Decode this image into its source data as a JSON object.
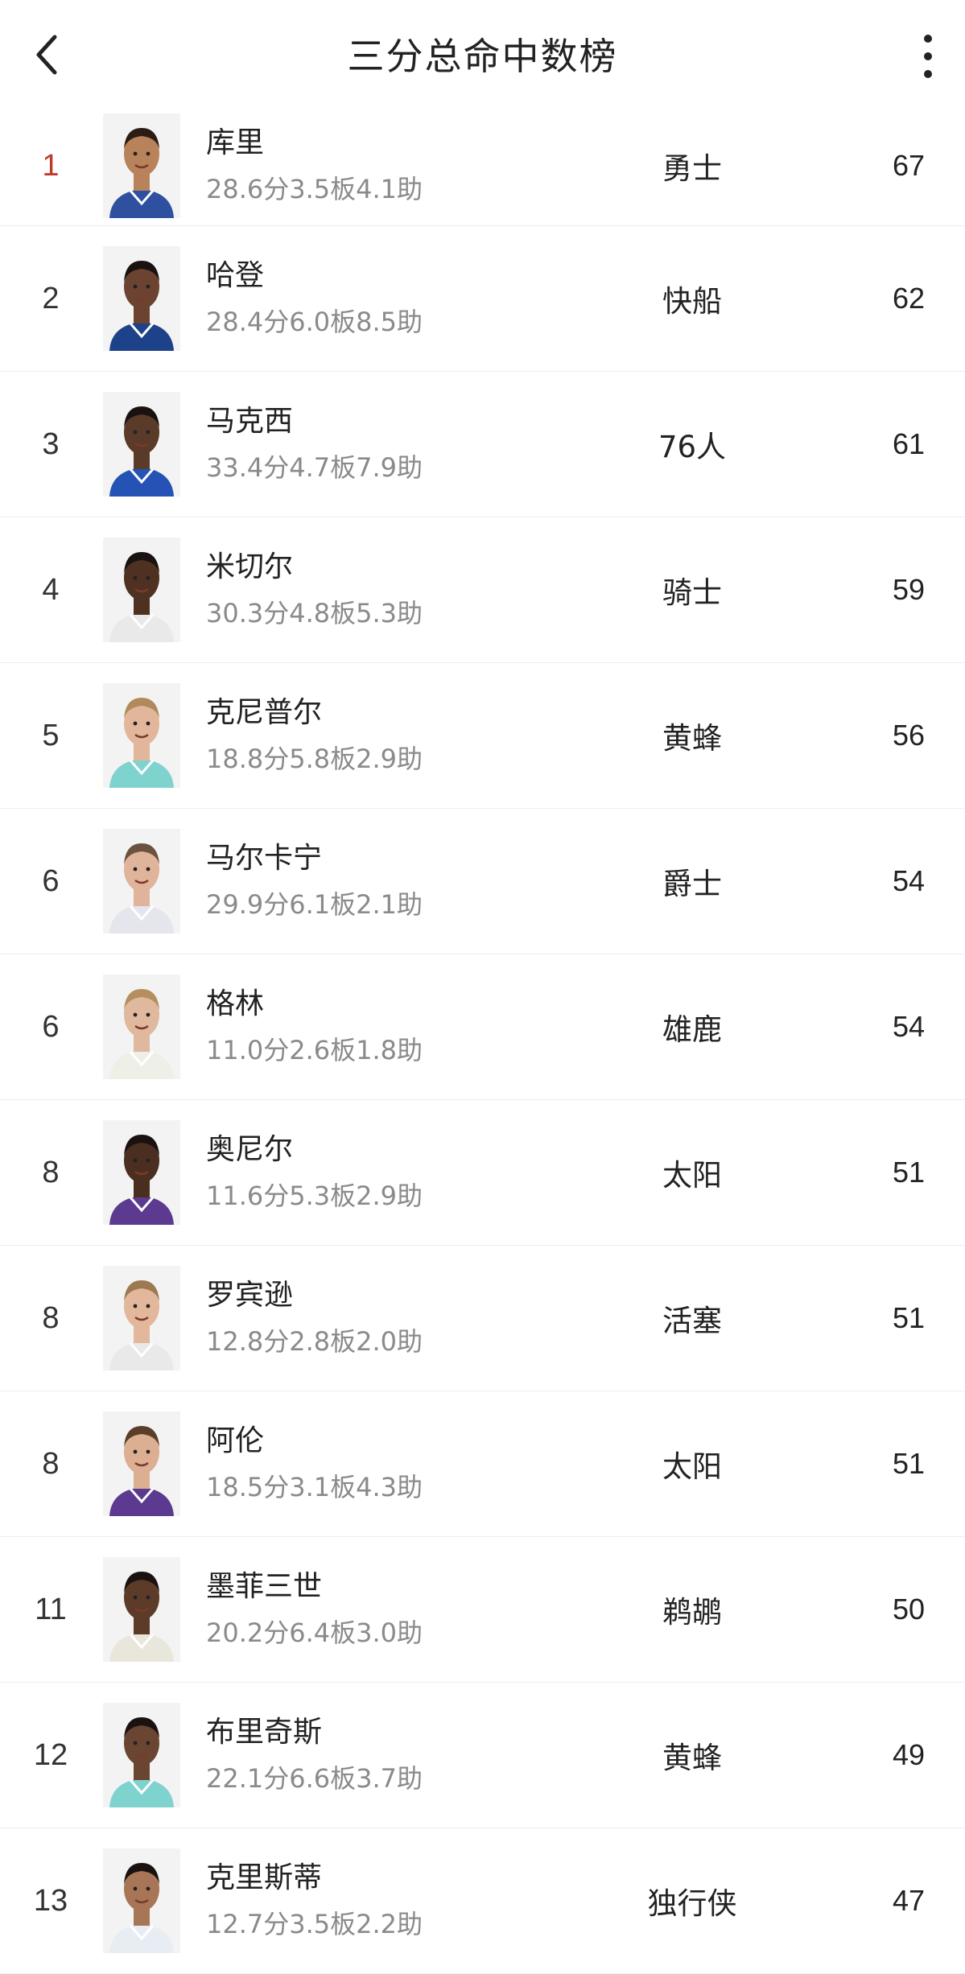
{
  "header": {
    "title": "三分总命中数榜"
  },
  "rows": [
    {
      "rank": "1",
      "name": "库里",
      "stats": "28.6分3.5板4.1助",
      "team": "勇士",
      "value": "67",
      "jersey": "#2f4f9f",
      "skin": "#b8835b",
      "hair": "#2a1d14"
    },
    {
      "rank": "2",
      "name": "哈登",
      "stats": "28.4分6.0板8.5助",
      "team": "快船",
      "value": "62",
      "jersey": "#1d428a",
      "skin": "#6b4330",
      "hair": "#1a1210"
    },
    {
      "rank": "3",
      "name": "马克西",
      "stats": "33.4分4.7板7.9助",
      "team": "76人",
      "value": "61",
      "jersey": "#2452b5",
      "skin": "#5a3a28",
      "hair": "#1a1210"
    },
    {
      "rank": "4",
      "name": "米切尔",
      "stats": "30.3分4.8板5.3助",
      "team": "骑士",
      "value": "59",
      "jersey": "#e9e9e9",
      "skin": "#4e3121",
      "hair": "#1a1210"
    },
    {
      "rank": "5",
      "name": "克尼普尔",
      "stats": "18.8分5.8板2.9助",
      "team": "黄蜂",
      "value": "56",
      "jersey": "#7fd3cf",
      "skin": "#e2b69a",
      "hair": "#b08a5c"
    },
    {
      "rank": "6",
      "name": "马尔卡宁",
      "stats": "29.9分6.1板2.1助",
      "team": "爵士",
      "value": "54",
      "jersey": "#e5e5ee",
      "skin": "#dfb49a",
      "hair": "#6b5240"
    },
    {
      "rank": "6",
      "name": "格林",
      "stats": "11.0分2.6板1.8助",
      "team": "雄鹿",
      "value": "54",
      "jersey": "#eef0e8",
      "skin": "#e0b89e",
      "hair": "#b58f5e"
    },
    {
      "rank": "8",
      "name": "奥尼尔",
      "stats": "11.6分5.3板2.9助",
      "team": "太阳",
      "value": "51",
      "jersey": "#5b3a8f",
      "skin": "#4a2e20",
      "hair": "#1a1210"
    },
    {
      "rank": "8",
      "name": "罗宾逊",
      "stats": "12.8分2.8板2.0助",
      "team": "活塞",
      "value": "51",
      "jersey": "#e9e9e9",
      "skin": "#e2b79c",
      "hair": "#9b7a52"
    },
    {
      "rank": "8",
      "name": "阿伦",
      "stats": "18.5分3.1板4.3助",
      "team": "太阳",
      "value": "51",
      "jersey": "#5b3a8f",
      "skin": "#dcae92",
      "hair": "#5a3e2a"
    },
    {
      "rank": "11",
      "name": "墨菲三世",
      "stats": "20.2分6.4板3.0助",
      "team": "鹈鹕",
      "value": "50",
      "jersey": "#e9e6dc",
      "skin": "#5c3b28",
      "hair": "#1a1210"
    },
    {
      "rank": "12",
      "name": "布里奇斯",
      "stats": "22.1分6.6板3.7助",
      "team": "黄蜂",
      "value": "49",
      "jersey": "#7fd3cf",
      "skin": "#6a4532",
      "hair": "#1a1210"
    },
    {
      "rank": "13",
      "name": "克里斯蒂",
      "stats": "12.7分3.5板2.2助",
      "team": "独行侠",
      "value": "47",
      "jersey": "#e8ecf3",
      "skin": "#a87656",
      "hair": "#1a1210"
    }
  ]
}
